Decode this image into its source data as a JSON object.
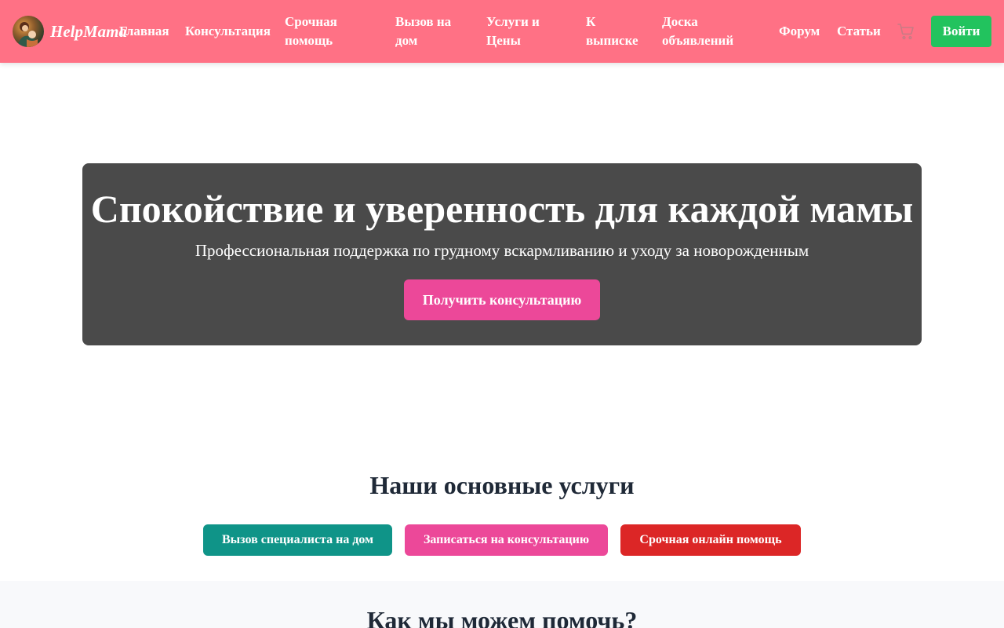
{
  "header": {
    "logo_text": "HelpMama",
    "nav": [
      {
        "label": "Главная"
      },
      {
        "label": "Консультация"
      },
      {
        "label": "Срочная помощь"
      },
      {
        "label": "Вызов на дом"
      },
      {
        "label": "Услуги и Цены"
      },
      {
        "label": "К выписке"
      },
      {
        "label": "Доска объявлений"
      },
      {
        "label": "Форум"
      },
      {
        "label": "Статьи"
      }
    ],
    "cart_icon": "shopping-cart-icon",
    "login_label": "Войти",
    "colors": {
      "background": "#ff7185",
      "login": "#22c35e"
    }
  },
  "hero": {
    "title": "Спокойствие и уверенность для каждой мамы",
    "subtitle": "Профессиональная поддержка по грудному вскармливанию и уходу за новорожденным",
    "cta_label": "Получить консультацию",
    "colors": {
      "background": "#4a4a4a",
      "cta": "#ec4899"
    }
  },
  "services": {
    "title": "Наши основные услуги",
    "buttons": [
      {
        "label": "Вызов специалиста на дом",
        "color": "#0f9488"
      },
      {
        "label": "Записаться на консультацию",
        "color": "#ec4899"
      },
      {
        "label": "Срочная онлайн помощь",
        "color": "#dc2626"
      }
    ]
  },
  "help": {
    "title": "Как мы можем помочь?"
  }
}
